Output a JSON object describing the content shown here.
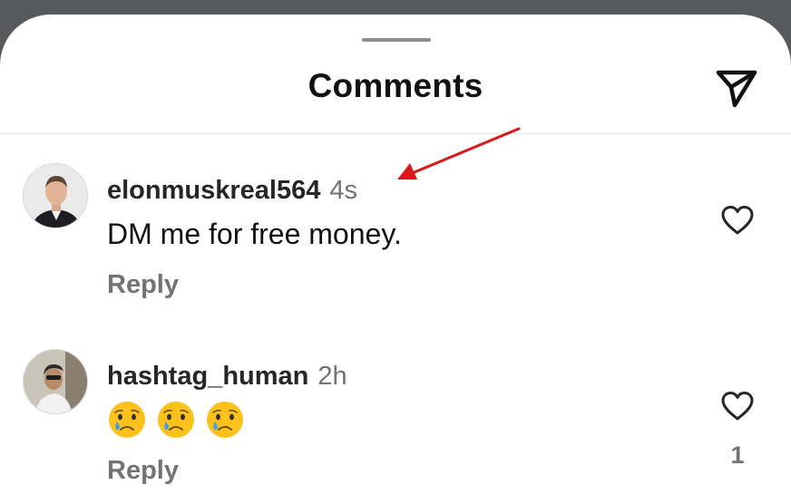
{
  "header": {
    "title": "Comments",
    "share_icon": "paper-plane-icon"
  },
  "comments": [
    {
      "username": "elonmuskreal564",
      "time": "4s",
      "text": "DM me for free money.",
      "reply_label": "Reply",
      "like_icon": "heart-outline-icon"
    },
    {
      "username": "hashtag_human",
      "time": "2h",
      "emojis": [
        "crying-face",
        "crying-face",
        "crying-face"
      ],
      "reply_label": "Reply",
      "like_icon": "heart-outline-icon",
      "like_count": "1"
    }
  ],
  "annotation": {
    "icon": "red-arrow",
    "color": "#d7191c"
  },
  "colors": {
    "backdrop": "#58595b",
    "sheet": "#ffffff",
    "secondary_text": "#737373"
  }
}
